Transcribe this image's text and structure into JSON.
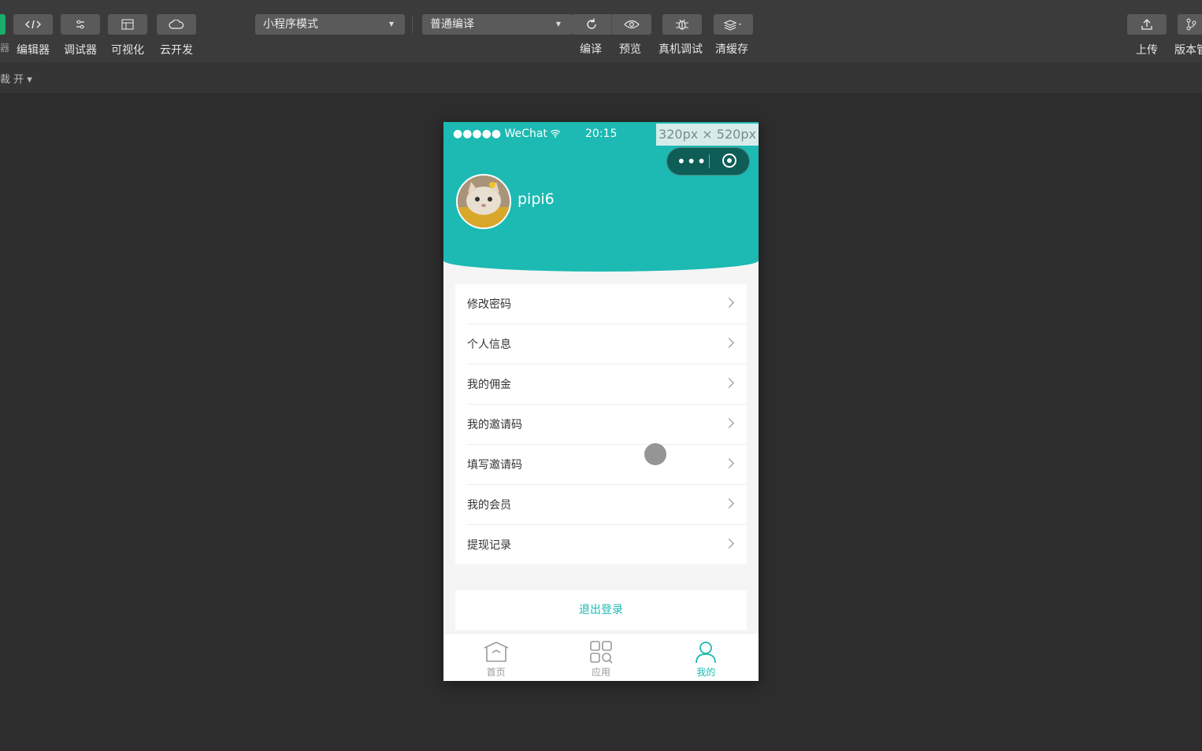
{
  "toolbar": {
    "left_tools": [
      "编辑器",
      "调试器",
      "可视化",
      "云开发"
    ],
    "mode_select": "小程序模式",
    "compile_select": "普通编译",
    "actions": [
      "编译",
      "预览",
      "真机调试",
      "清缓存"
    ],
    "right_tools": [
      "上传",
      "版本管"
    ],
    "cut_text": "器"
  },
  "subbar": {
    "text": "裁 开 ▾"
  },
  "phone": {
    "signal": "●●●●● WeChat",
    "time": "20:15",
    "size_badge": "320px × 520px",
    "username": "pipi6",
    "menu": [
      "修改密码",
      "个人信息",
      "我的佣金",
      "我的邀请码",
      "填写邀请码",
      "我的会员",
      "提现记录"
    ],
    "logout": "退出登录",
    "tabs": [
      {
        "label": "首页",
        "icon": "home-icon"
      },
      {
        "label": "应用",
        "icon": "apps-grid-icon"
      },
      {
        "label": "我的",
        "icon": "user-icon"
      }
    ],
    "colors": {
      "accent": "#1cbab2",
      "capsule": "#0e5d57"
    }
  }
}
